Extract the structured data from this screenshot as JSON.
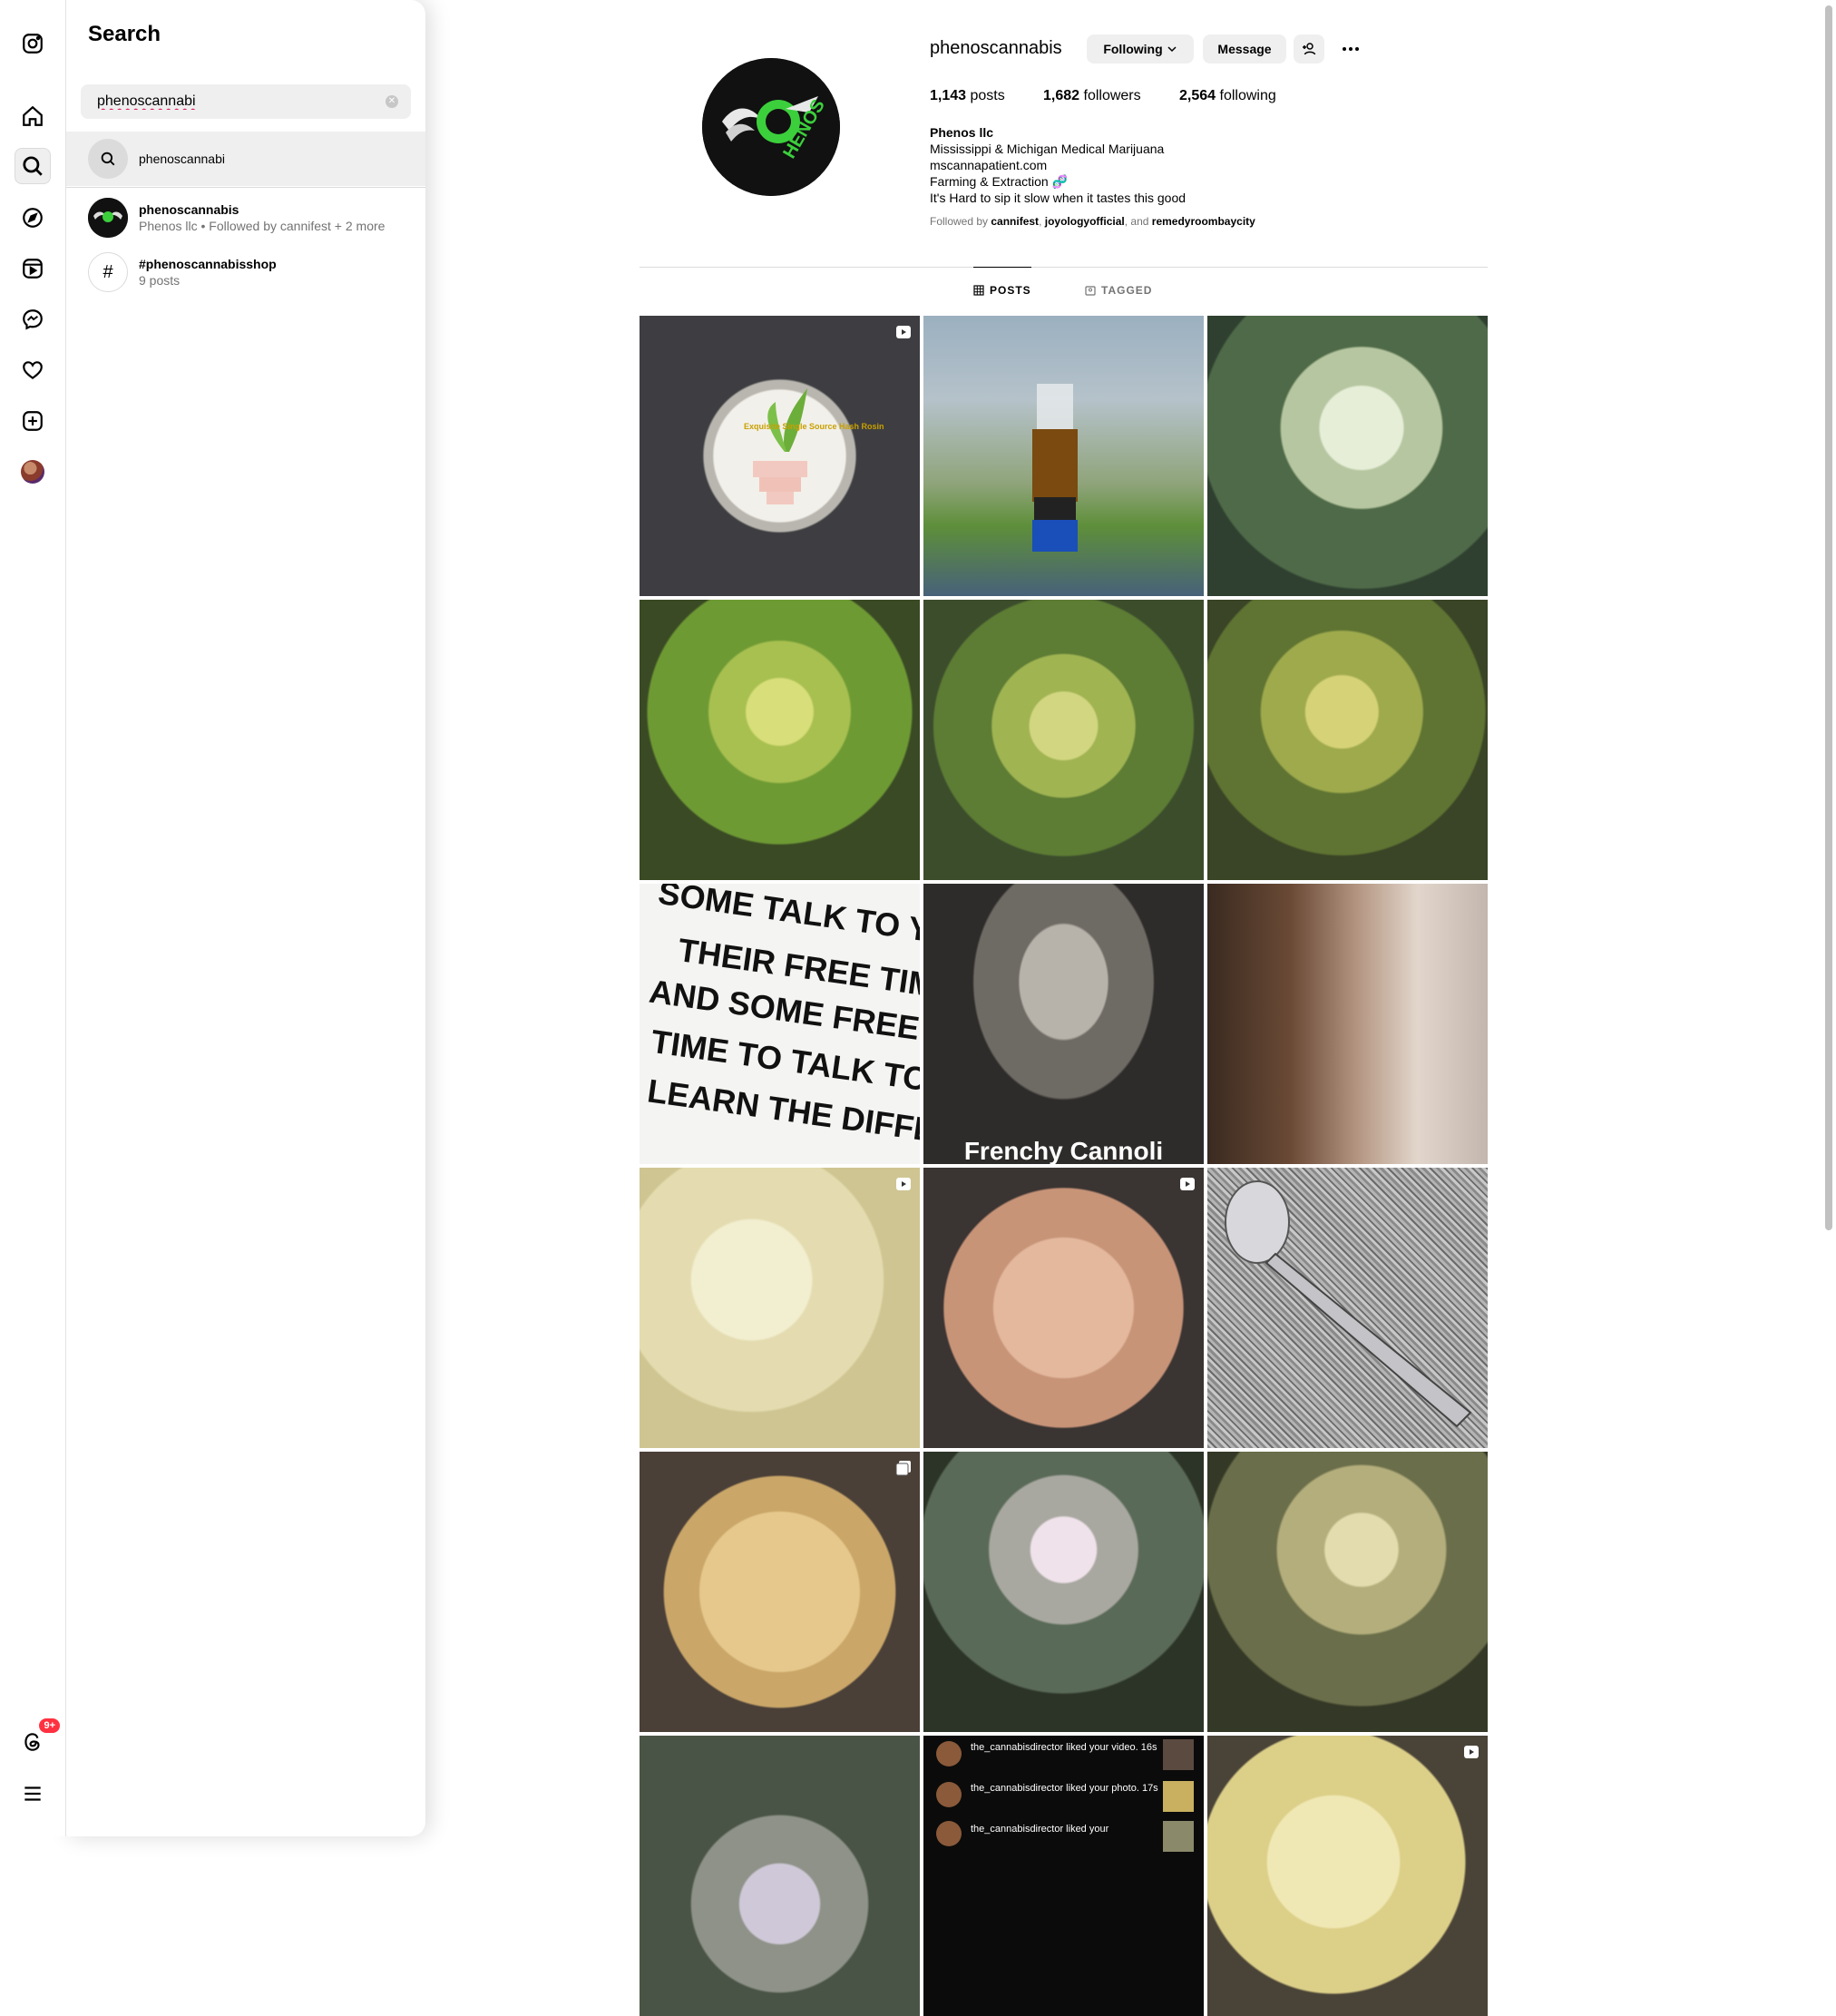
{
  "search": {
    "title": "Search",
    "query": "phenoscannabi",
    "results": [
      {
        "main": "phenoscannabi",
        "sub": ""
      },
      {
        "main": "phenoscannabis",
        "sub": "Phenos llc • Followed by cannifest + 2 more"
      },
      {
        "main": "#phenoscannabisshop",
        "sub": "9 posts"
      }
    ]
  },
  "nav": {
    "badge": "9+",
    "icons": [
      "instagram-icon",
      "home-icon",
      "search-icon",
      "explore-icon",
      "reels-icon",
      "messenger-icon",
      "heart-icon",
      "create-icon",
      "profile-avatar",
      "threads-icon",
      "menu-icon"
    ]
  },
  "profile": {
    "username": "phenoscannabis",
    "following_label": "Following",
    "message_label": "Message",
    "logo_text": "HENOS",
    "stats": {
      "posts": "1,143",
      "posts_label": "posts",
      "followers": "1,682",
      "followers_label": "followers",
      "following": "2,564",
      "following_label": "following"
    },
    "bio": {
      "name": "Phenos llc",
      "line1": "Mississippi & Michigan Medical Marijuana",
      "line2": "mscannapatient.com",
      "line3": "Farming & Extraction 🧬",
      "line4": "It's Hard to sip it slow when it tastes this good"
    },
    "followed_by": {
      "prefix": "Followed by ",
      "a": "cannifest",
      "sep1": ", ",
      "b": "joyologyofficial",
      "sep2": ", and ",
      "c": "remedyroombaycity"
    }
  },
  "tabs": {
    "posts": "POSTS",
    "tagged": "TAGGED"
  },
  "grid": {
    "tile1_text": "Exquisite Single Source Hash Rosin",
    "tile7_lines": [
      "SOME TALK TO YOU IN",
      "THEIR FREE TIME,",
      "AND SOME FREE THEIR",
      "TIME TO TALK TO YOU.",
      "LEARN THE DIFFERENCE"
    ],
    "tile8_caption": "Frenchy Cannoli",
    "tile17_lines": [
      "the_cannabisdirector liked your video. 16s",
      "the_cannabisdirector liked your photo. 17s",
      "the_cannabisdirector liked your"
    ]
  },
  "colors": {
    "accent_green": "#3ccf3c",
    "badge_red": "#ff3040"
  }
}
